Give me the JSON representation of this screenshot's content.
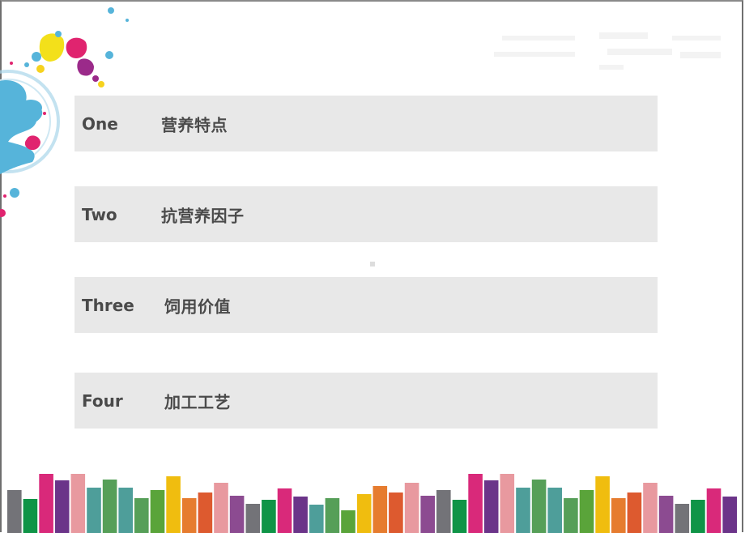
{
  "slide": {
    "items": [
      {
        "number": "One",
        "title": "营养特点"
      },
      {
        "number": "Two",
        "title": "抗营养因子"
      },
      {
        "number": "Three",
        "title": "饲用价值"
      },
      {
        "number": "Four",
        "title": "加工工艺"
      }
    ]
  },
  "decor": {
    "splash_colors": [
      "#f3e01a",
      "#e0246f",
      "#9b2a8a",
      "#56b4da",
      "#f6d21e"
    ],
    "bar_colors": [
      "#737378",
      "#0f9447",
      "#d9297a",
      "#6b3489",
      "#e8999f",
      "#4e9e9a",
      "#569f58",
      "#4e9e9a",
      "#569f58",
      "#5aa43a",
      "#f0bd0f",
      "#e67c2f",
      "#dd5a2f",
      "#e8999f",
      "#8c4b91",
      "#737378",
      "#0f9447",
      "#d9297a",
      "#6b3489",
      "#4e9e9a",
      "#569f58",
      "#5aa43a",
      "#f0bd0f",
      "#e67c2f",
      "#dd5a2f",
      "#e8999f",
      "#8c4b91",
      "#737378",
      "#0f9447",
      "#d9297a",
      "#6b3489",
      "#e8999f",
      "#4e9e9a",
      "#569f58",
      "#4e9e9a",
      "#569f58",
      "#5aa43a",
      "#f0bd0f",
      "#e67c2f",
      "#dd5a2f",
      "#e8999f",
      "#8c4b91",
      "#737378",
      "#0f9447",
      "#d9297a",
      "#6b3489"
    ]
  }
}
